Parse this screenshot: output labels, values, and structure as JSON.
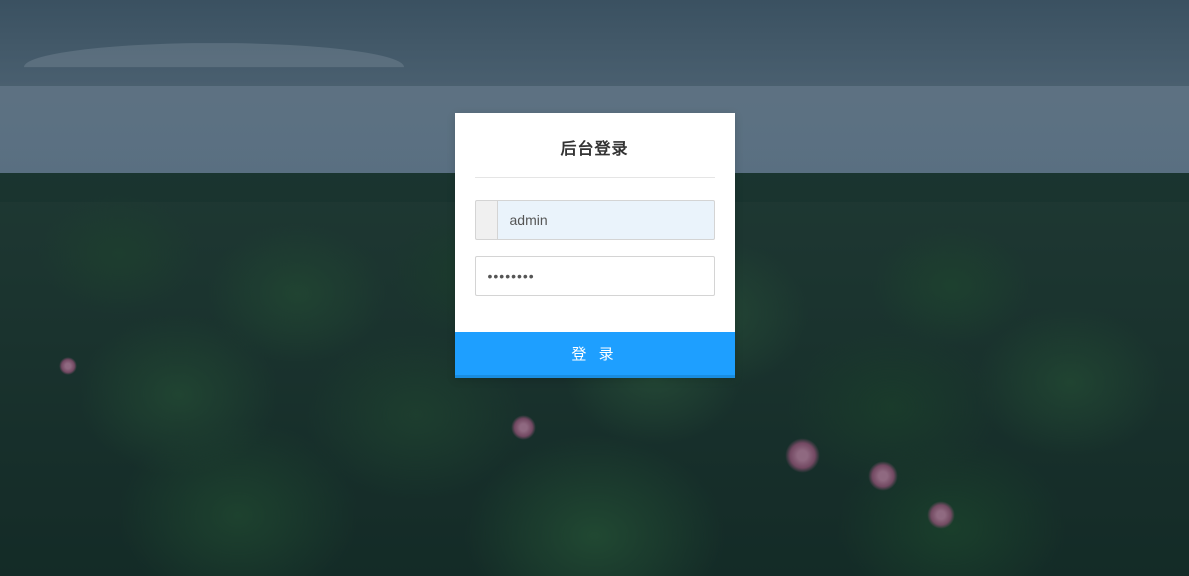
{
  "login": {
    "title": "后台登录",
    "username_value": "admin",
    "username_placeholder": "",
    "password_value": "••••••••",
    "password_placeholder": "",
    "submit_label": "登 录"
  },
  "colors": {
    "primary": "#1e9fff",
    "input_bg_filled": "#eaf3fb",
    "input_border": "#d4d4d4",
    "text_dark": "#333333"
  }
}
